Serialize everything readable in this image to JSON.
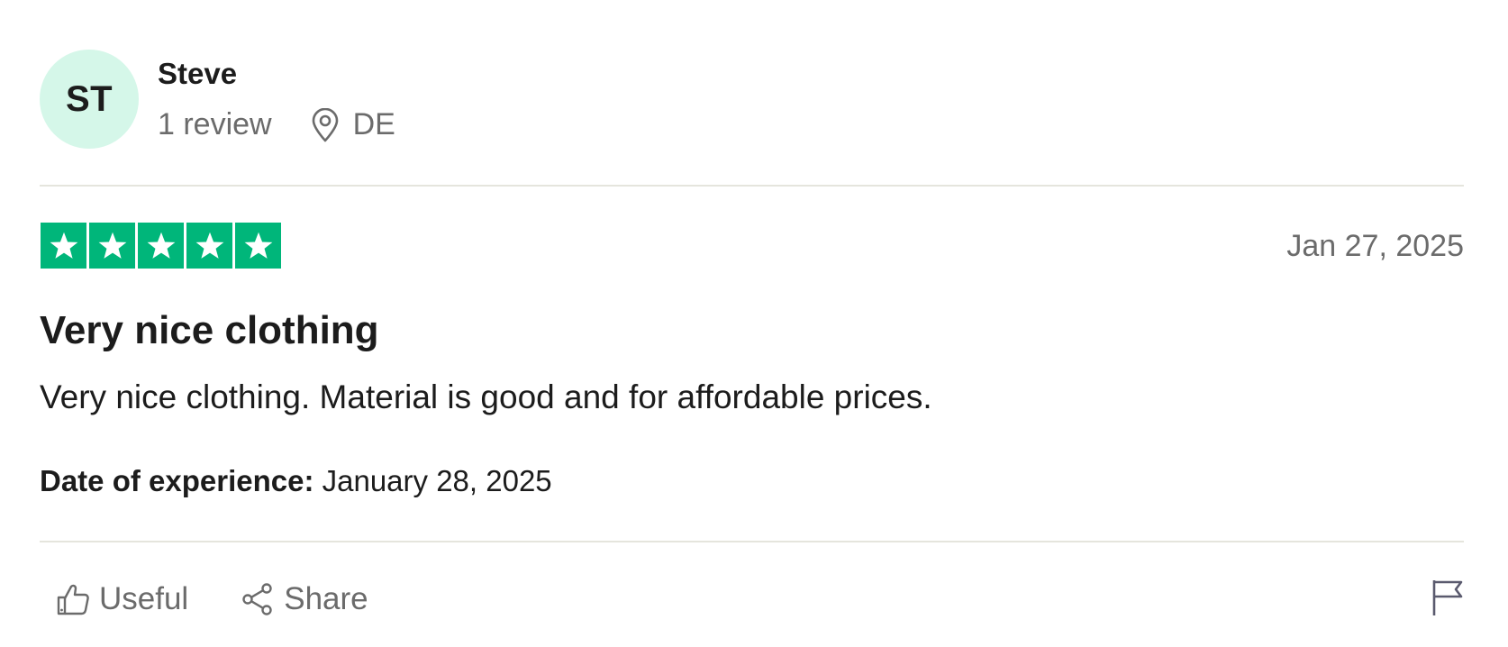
{
  "reviewer": {
    "initials": "ST",
    "name": "Steve",
    "review_count": "1 review",
    "country": "DE",
    "avatar_color": "#d5f7e9"
  },
  "rating": {
    "stars": 5,
    "max": 5,
    "color": "#00b67a"
  },
  "review": {
    "date": "Jan 27, 2025",
    "title": "Very nice clothing",
    "body": "Very nice clothing. Material is good and for affordable prices.",
    "experience_label": "Date of experience:",
    "experience_date": "January 28, 2025"
  },
  "actions": {
    "useful_label": "Useful",
    "share_label": "Share",
    "icons": [
      "thumbs-up-icon",
      "share-icon",
      "flag-icon"
    ]
  }
}
